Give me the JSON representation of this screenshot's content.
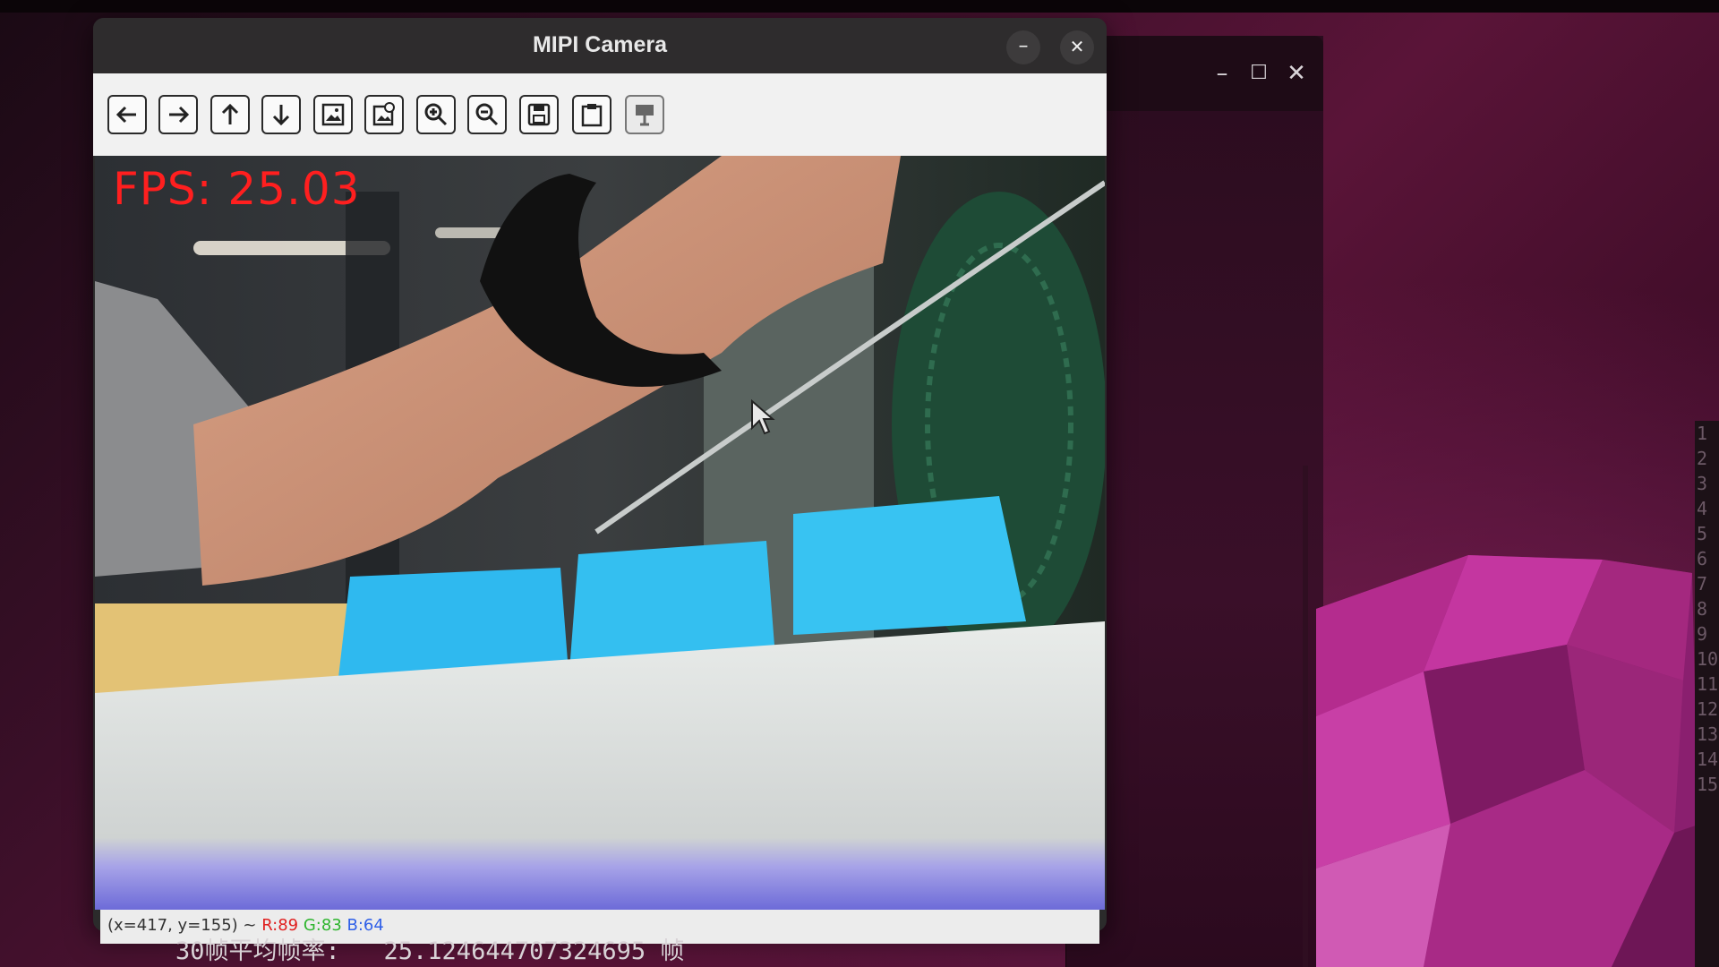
{
  "camera_window": {
    "title": "MIPI Camera",
    "minimize_glyph": "–",
    "close_glyph": "✕",
    "toolbar": [
      {
        "name": "pan-left-icon"
      },
      {
        "name": "pan-right-icon"
      },
      {
        "name": "pan-up-icon"
      },
      {
        "name": "pan-down-icon"
      },
      {
        "name": "zoom-fit-image-icon"
      },
      {
        "name": "zoom-original-icon"
      },
      {
        "name": "zoom-in-icon"
      },
      {
        "name": "zoom-out-icon"
      },
      {
        "name": "save-image-icon"
      },
      {
        "name": "copy-to-clipboard-icon"
      },
      {
        "name": "properties-icon"
      }
    ],
    "fps_overlay": "FPS: 25.03",
    "status": {
      "coords": "(x=417, y=155) ~ ",
      "r": "R:89",
      "g": "G:83",
      "b": "B:64"
    }
  },
  "terminal_window": {
    "minimize_glyph": "–",
    "maximize_glyph": "☐",
    "close_glyph": "✕"
  },
  "console": {
    "text": "30帧平均帧率:   25.124644707324695 帧"
  },
  "edge_numbers": [
    "1",
    "2",
    "3",
    "4",
    "5",
    "6",
    "7",
    "8",
    "9",
    "10",
    "11",
    "12",
    "13",
    "14",
    "15"
  ]
}
